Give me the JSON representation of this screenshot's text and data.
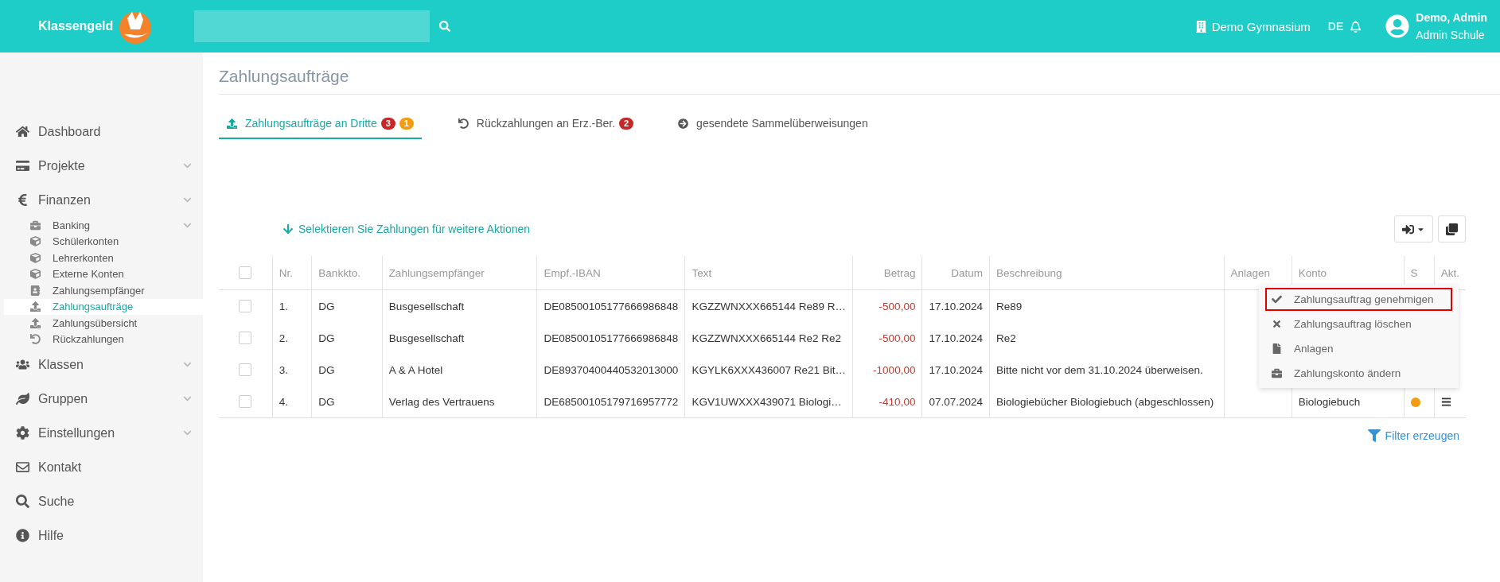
{
  "header": {
    "brand": "Klassengeld",
    "school": "Demo Gymnasium",
    "language": {
      "label": "DE",
      "selected": true
    },
    "user_name": "Demo, Admin",
    "user_role": "Admin Schule"
  },
  "sidebar": {
    "items": [
      {
        "label": "Dashboard",
        "expandable": false,
        "selected": false
      },
      {
        "label": "Projekte",
        "expandable": true,
        "selected": false
      },
      {
        "label": "Finanzen",
        "expandable": true,
        "selected": false,
        "children": [
          {
            "label": "Banking",
            "expandable": true,
            "selected": false
          },
          {
            "label": "Schülerkonten",
            "expandable": false,
            "selected": false
          },
          {
            "label": "Lehrerkonten",
            "expandable": false,
            "selected": false
          },
          {
            "label": "Externe Konten",
            "expandable": false,
            "selected": false
          },
          {
            "label": "Zahlungsempfänger",
            "expandable": false,
            "selected": false
          },
          {
            "label": "Zahlungsaufträge",
            "expandable": false,
            "selected": true
          },
          {
            "label": "Zahlungsübersicht",
            "expandable": false,
            "selected": false
          },
          {
            "label": "Rückzahlungen",
            "expandable": false,
            "selected": false
          }
        ]
      },
      {
        "label": "Klassen",
        "expandable": true,
        "selected": false
      },
      {
        "label": "Gruppen",
        "expandable": true,
        "selected": false
      },
      {
        "label": "Einstellungen",
        "expandable": true,
        "selected": false
      },
      {
        "label": "Kontakt",
        "expandable": false,
        "selected": false
      },
      {
        "label": "Suche",
        "expandable": false,
        "selected": false
      },
      {
        "label": "Hilfe",
        "expandable": false,
        "selected": false
      }
    ]
  },
  "page_title": "Zahlungsaufträge",
  "tabs": [
    {
      "label": "Zahlungsaufträge an Dritte",
      "selected": true,
      "badges": [
        {
          "text": "3",
          "color": "#c62828"
        },
        {
          "text": "1",
          "color": "#f39c12"
        }
      ]
    },
    {
      "label": "Rückzahlungen an Erz.-Ber.",
      "selected": false,
      "badges": [
        {
          "text": "2",
          "color": "#c62828"
        }
      ]
    },
    {
      "label": "gesendete Sammelüberweisungen",
      "selected": false
    }
  ],
  "action_hint": "Selektieren Sie Zahlungen für weitere Aktionen",
  "table": {
    "select_all_checked": false,
    "columns": [
      "Nr.",
      "Bankkto.",
      "Zahlungsempfänger",
      "Empf.-IBAN",
      "Text",
      "Betrag",
      "Datum",
      "Beschreibung",
      "Anlagen",
      "Konto",
      "S",
      "Akt."
    ],
    "rows": [
      {
        "checked": false,
        "nr": "1.",
        "bank": "DG",
        "payee": "Busgesellschaft",
        "iban": "DE08500105177666986848",
        "text": "KGZZWNXXX665144 Re89 R…",
        "amount": "-500,00",
        "date": "17.10.2024",
        "description": "Re89"
      },
      {
        "checked": false,
        "nr": "2.",
        "bank": "DG",
        "payee": "Busgesellschaft",
        "iban": "DE08500105177666986848",
        "text": "KGZZWNXXX665144 Re2 Re2",
        "amount": "-500,00",
        "date": "17.10.2024",
        "description": "Re2"
      },
      {
        "checked": false,
        "nr": "3.",
        "bank": "DG",
        "payee": "A & A Hotel",
        "iban": "DE89370400440532013000",
        "text": "KGYLK6XXX436007 Re21 Bit…",
        "amount": "-1000,00",
        "date": "17.10.2024",
        "description": "Bitte nicht vor dem 31.10.2024 überweisen."
      },
      {
        "checked": false,
        "nr": "4.",
        "bank": "DG",
        "payee": "Verlag des Vertrauens",
        "iban": "DE68500105179716957772",
        "text": "KGV1UWXXX439071 Biologi…",
        "amount": "-410,00",
        "date": "07.07.2024",
        "description": "Biologiebücher Biologiebuch (abgeschlossen)",
        "account": "Biologiebuch",
        "color": "#f39c12"
      }
    ]
  },
  "context_menu": {
    "items": [
      {
        "label": "Zahlungsauftrag genehmigen",
        "highlighted": true
      },
      {
        "label": "Zahlungsauftrag löschen",
        "highlighted": false
      },
      {
        "label": "Anlagen",
        "highlighted": false
      },
      {
        "label": "Zahlungskonto ändern",
        "highlighted": false
      }
    ]
  },
  "filter_link": "Filter erzeugen"
}
